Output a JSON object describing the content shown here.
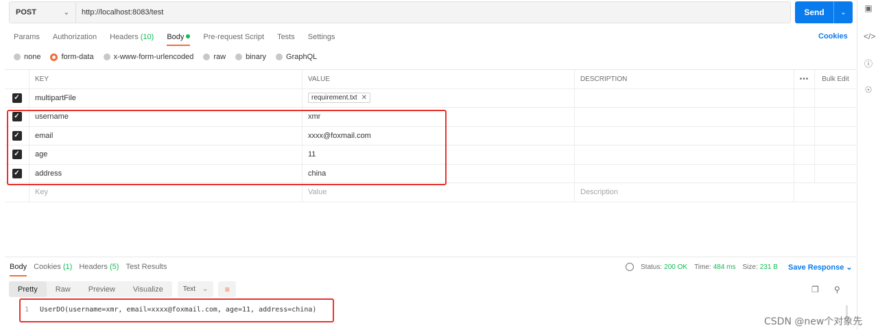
{
  "request": {
    "method": "POST",
    "url": "http://localhost:8083/test",
    "send_label": "Send"
  },
  "tabs": [
    {
      "label": "Params"
    },
    {
      "label": "Authorization"
    },
    {
      "label": "Headers",
      "count": "(10)"
    },
    {
      "label": "Body"
    },
    {
      "label": "Pre-request Script"
    },
    {
      "label": "Tests"
    },
    {
      "label": "Settings"
    }
  ],
  "cookies_label": "Cookies",
  "body_modes": [
    "none",
    "form-data",
    "x-www-form-urlencoded",
    "raw",
    "binary",
    "GraphQL"
  ],
  "body_mode_selected": "form-data",
  "table": {
    "headers": {
      "key": "KEY",
      "value": "VALUE",
      "description": "DESCRIPTION",
      "more": "•••",
      "bulk": "Bulk Edit"
    },
    "rows": [
      {
        "key": "multipartFile",
        "value": "requirement.txt",
        "is_file": true
      },
      {
        "key": "username",
        "value": "xmr"
      },
      {
        "key": "email",
        "value": "xxxx@foxmail.com"
      },
      {
        "key": "age",
        "value": "11"
      },
      {
        "key": "address",
        "value": "china"
      }
    ],
    "placeholders": {
      "key": "Key",
      "value": "Value",
      "description": "Description"
    }
  },
  "response": {
    "tabs": [
      {
        "label": "Body"
      },
      {
        "label": "Cookies",
        "count": "(1)"
      },
      {
        "label": "Headers",
        "count": "(5)"
      },
      {
        "label": "Test Results"
      }
    ],
    "status_label": "Status:",
    "status_value": "200 OK",
    "time_label": "Time:",
    "time_value": "484 ms",
    "size_label": "Size:",
    "size_value": "231 B",
    "save_label": "Save Response",
    "views": [
      "Pretty",
      "Raw",
      "Preview",
      "Visualize"
    ],
    "format": "Text",
    "line_number": "1",
    "code": "UserDO(username=xmr, email=xxxx@foxmail.com, age=11, address=china)"
  },
  "watermark": "CSDN @new个对象先",
  "colors": {
    "accent": "#f26b3a",
    "send": "#097bed",
    "ok": "#0cbb52",
    "highlight": "#e8302c"
  }
}
